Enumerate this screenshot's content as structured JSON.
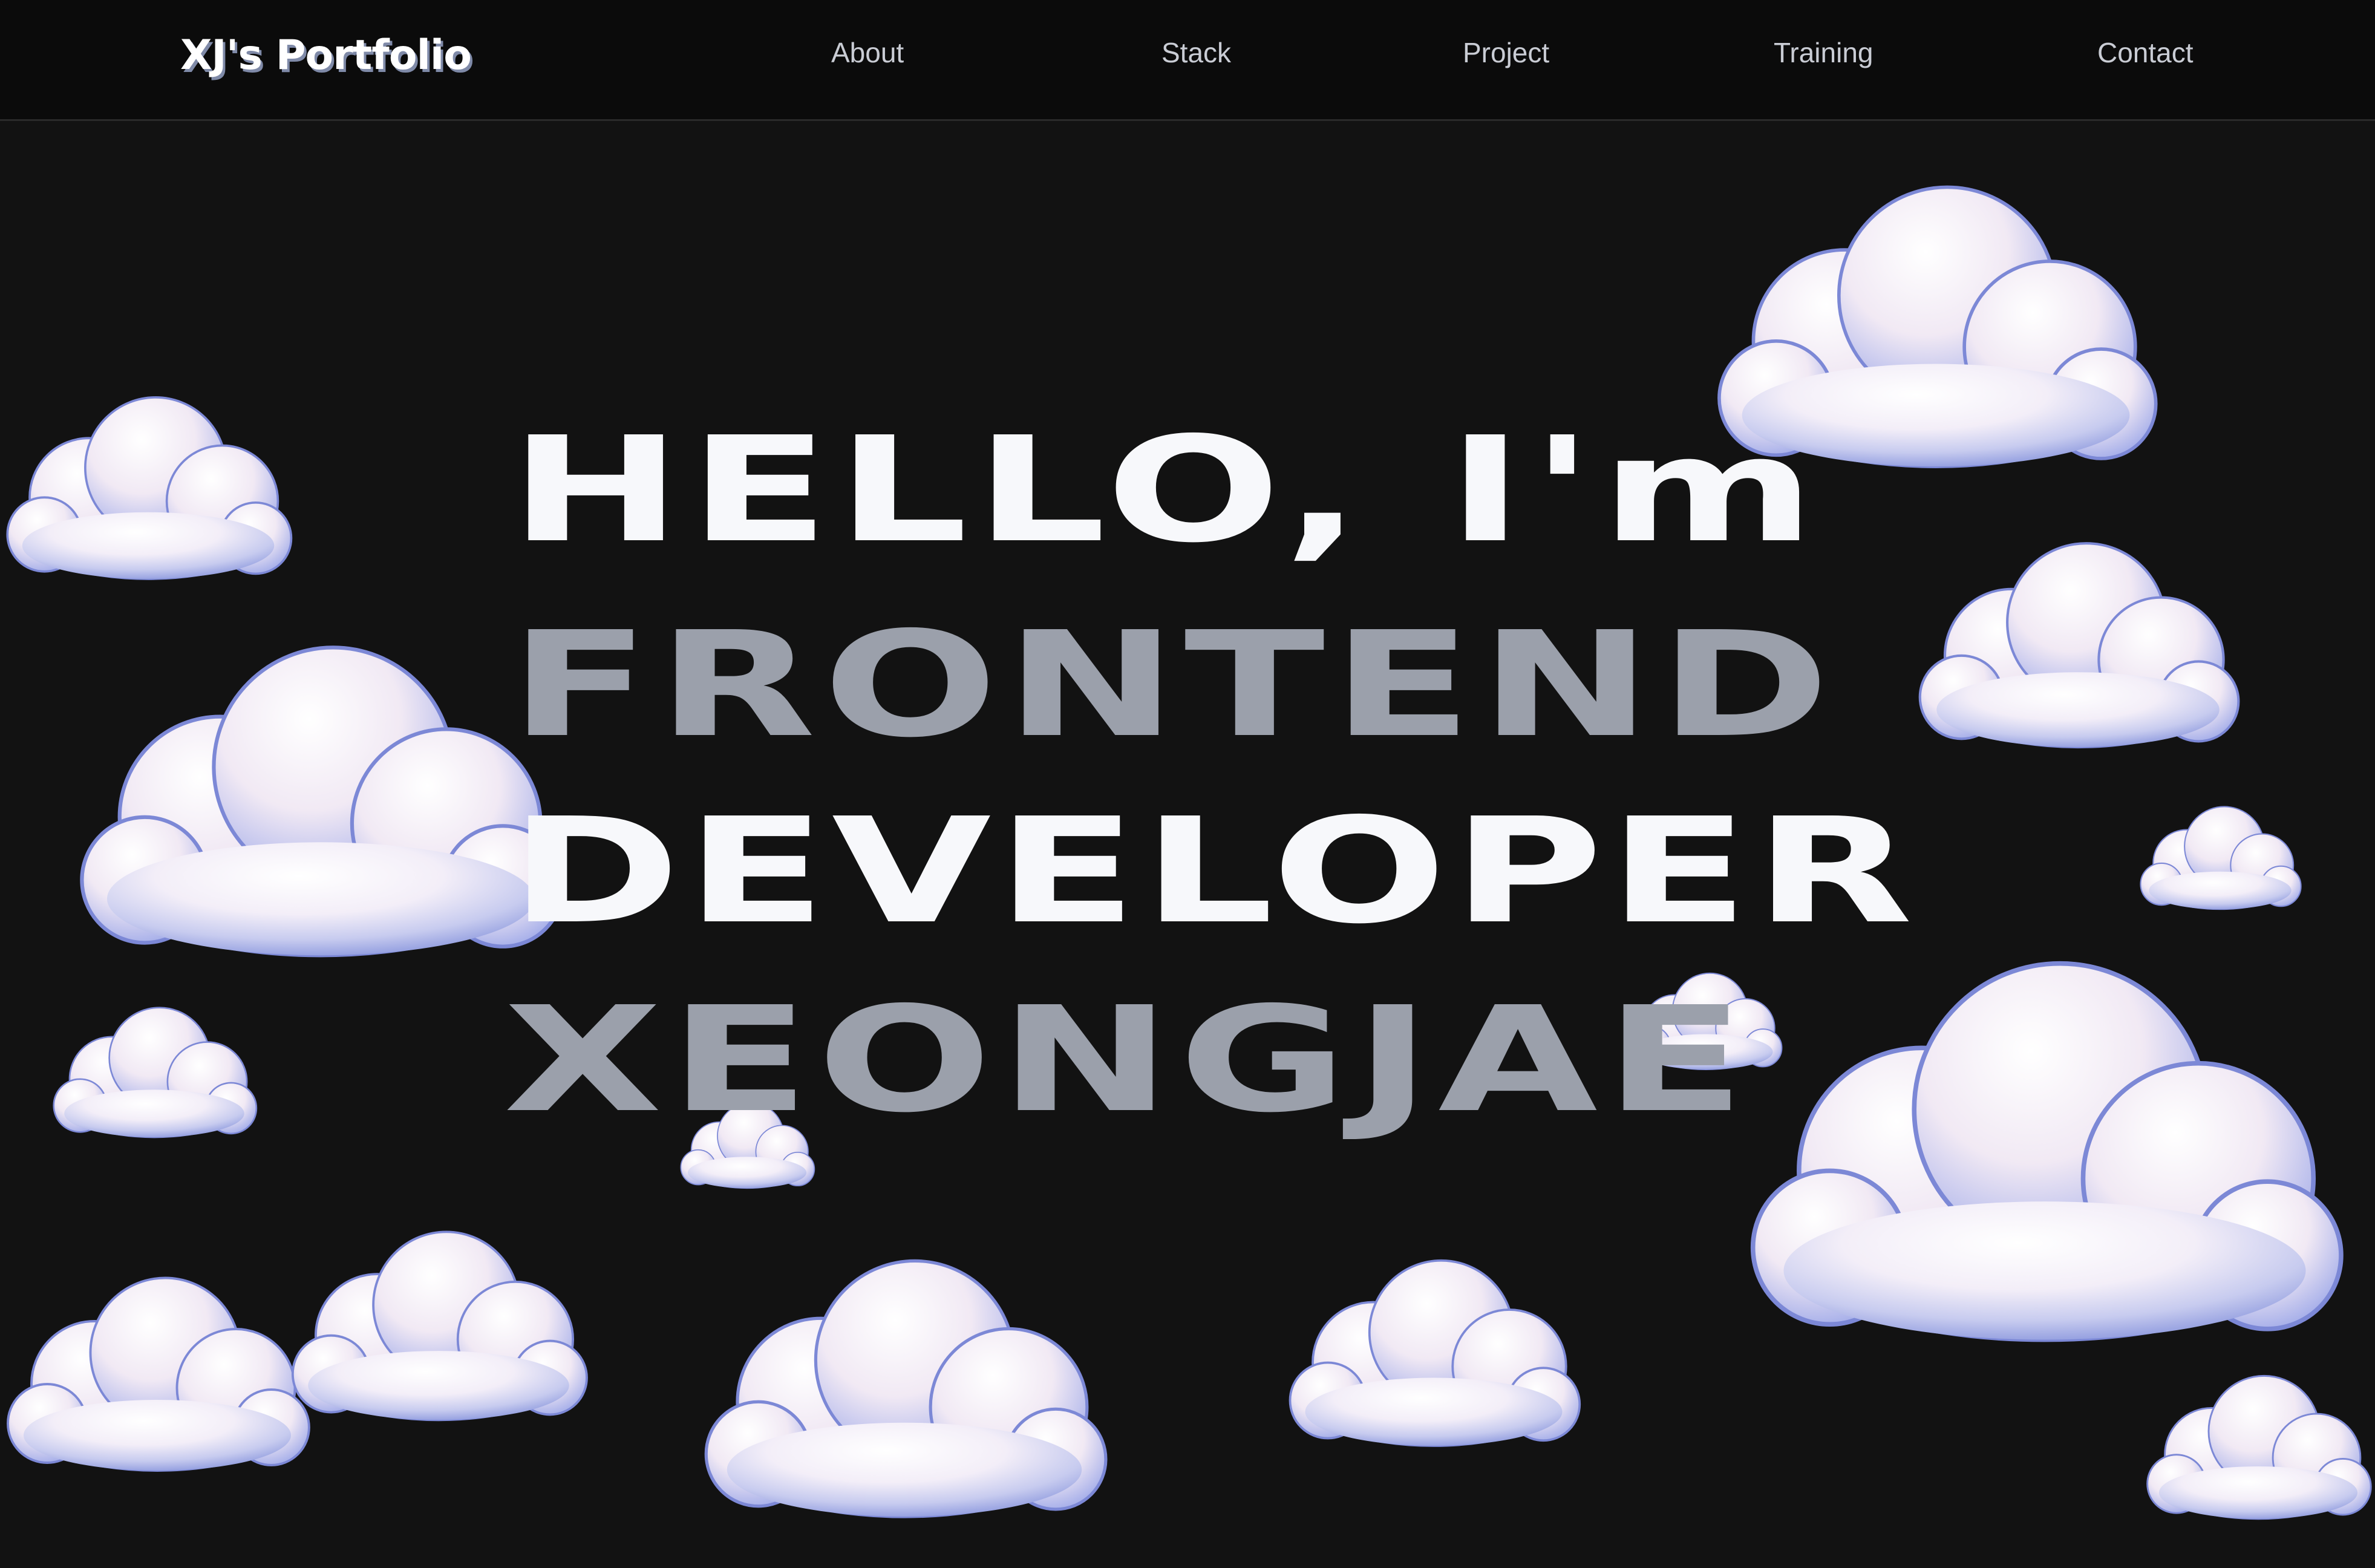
{
  "brand": "XJ's Portfolio",
  "nav": [
    {
      "label": "About"
    },
    {
      "label": "Stack"
    },
    {
      "label": "Project"
    },
    {
      "label": "Training"
    },
    {
      "label": "Contact"
    }
  ],
  "hero": {
    "line1": "HELLO, I'm",
    "line2": "FRONTEND",
    "line3": "DEVELOPER",
    "line4": "XEONGJAE"
  },
  "colors": {
    "background": "#121212",
    "navbar": "#0b0b0b",
    "hero_white": "#f7f8fb",
    "hero_gray": "#9ba0ab",
    "cloud_highlight": "#ffffff",
    "cloud_shadow": "#8e9ae0"
  }
}
